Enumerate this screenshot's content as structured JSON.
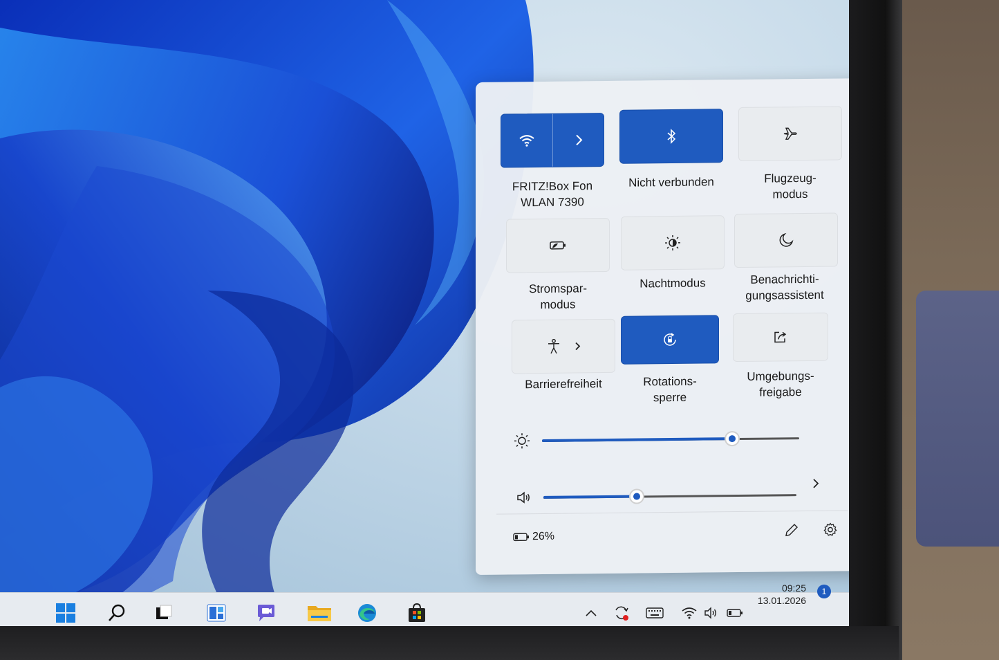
{
  "quick_settings": {
    "tiles": [
      {
        "id": "wifi",
        "label": "FRITZ!Box Fon WLAN 7390",
        "label_line1": "FRITZ!Box Fon",
        "label_line2": "WLAN 7390",
        "active": true,
        "icon": "wifi-icon"
      },
      {
        "id": "bluetooth",
        "label": "Nicht verbunden",
        "active": true,
        "icon": "bluetooth-icon"
      },
      {
        "id": "airplane",
        "label_line1": "Flugzeug-",
        "label_line2": "modus",
        "active": false,
        "icon": "airplane-icon"
      },
      {
        "id": "battery-saver",
        "label_line1": "Stromspar-",
        "label_line2": "modus",
        "active": false,
        "icon": "battery-saver-icon"
      },
      {
        "id": "night-light",
        "label": "Nachtmodus",
        "active": false,
        "icon": "night-light-icon"
      },
      {
        "id": "focus-assist",
        "label_line1": "Benachrichti-",
        "label_line2": "gungsassistent",
        "active": false,
        "icon": "moon-icon"
      },
      {
        "id": "accessibility",
        "label": "Barrierefreiheit",
        "active": false,
        "icon": "accessibility-icon"
      },
      {
        "id": "rotation-lock",
        "label_line1": "Rotations-",
        "label_line2": "sperre",
        "active": true,
        "icon": "rotation-lock-icon"
      },
      {
        "id": "nearby-sharing",
        "label_line1": "Umgebungs-",
        "label_line2": "freigabe",
        "active": false,
        "icon": "share-icon"
      }
    ],
    "brightness": {
      "value_fraction": 0.74,
      "icon": "sun-icon"
    },
    "volume": {
      "value_fraction": 0.37,
      "icon": "speaker-icon"
    },
    "battery_percent": "26%",
    "accent_color": "#1f5bbf"
  },
  "taskbar": {
    "apps": [
      "start-icon",
      "search-icon",
      "task-view-icon",
      "widgets-icon",
      "chat-icon",
      "file-explorer-icon",
      "edge-icon",
      "store-icon"
    ],
    "time": "09:25",
    "date": "13.01.2026",
    "notification_count": "1"
  }
}
